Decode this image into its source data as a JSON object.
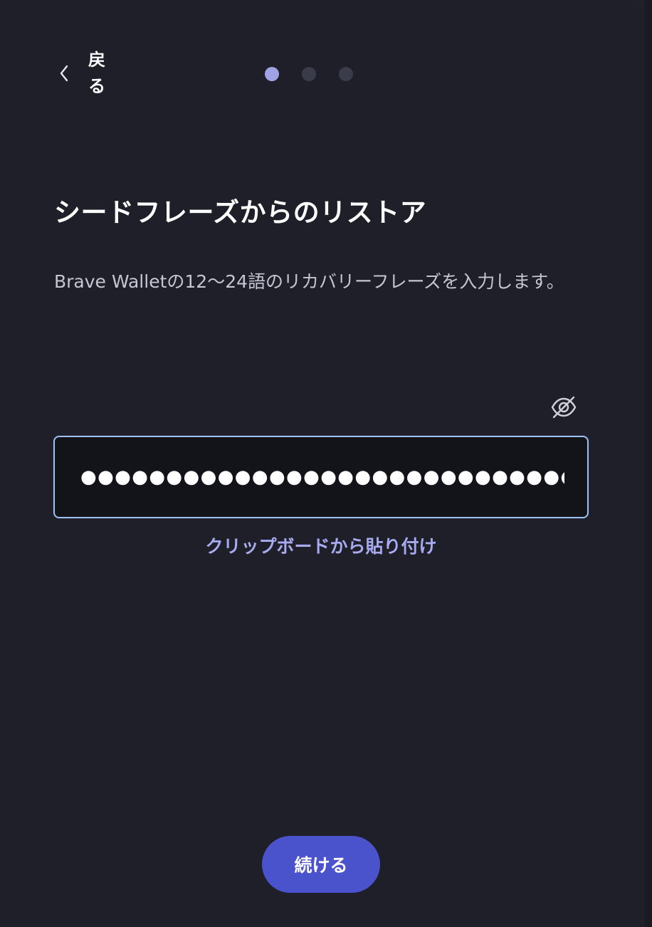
{
  "header": {
    "back_label": "戻る",
    "back_icon": "chevron-left-icon",
    "steps": [
      {
        "active": true
      },
      {
        "active": false
      },
      {
        "active": false
      }
    ]
  },
  "main": {
    "title": "シードフレーズからのリストア",
    "description": "Brave Walletの12〜24語のリカバリーフレーズを入力します。",
    "visibility_toggle_icon": "eye-slash-icon",
    "phrase_input": {
      "value": "●●●●●●●●●●●●●●●●●●●●●●●●●●●●●●●●●●●●●●●●●●●●●●●●",
      "type": "password"
    },
    "paste_label": "クリップボードから貼り付け",
    "continue_label": "続ける"
  },
  "colors": {
    "background": "#1e1f28",
    "accent": "#4b53cc",
    "link": "#a8abf0",
    "step_active": "#a0a3e3",
    "step_inactive": "#3a3c4c",
    "input_border": "#9ec3f3"
  }
}
